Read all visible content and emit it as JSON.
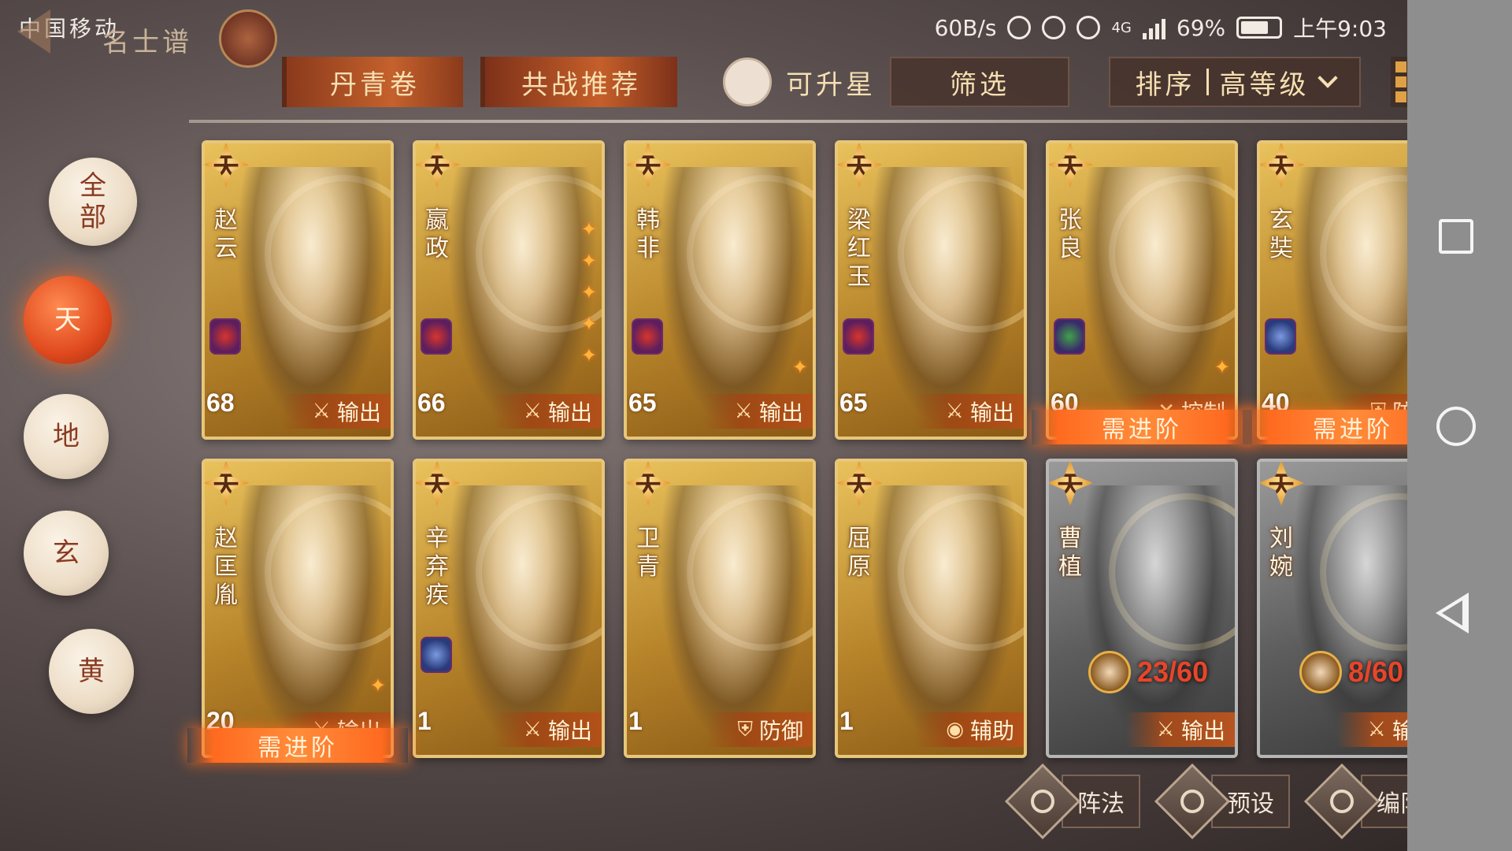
{
  "status_bar": {
    "carrier": "中国移动",
    "speed": "60B/s",
    "network": "4G",
    "battery": "69%",
    "time": "上午9:03"
  },
  "header": {
    "title": "名士谱"
  },
  "toolbar": {
    "danqing": "丹青卷",
    "gongzhan": "共战推荐",
    "upgradable": "可升星",
    "filter": "筛选",
    "sort_label": "排序",
    "sort_value": "高等级"
  },
  "filters": {
    "all": "全部",
    "tian": "天",
    "di": "地",
    "xuan": "玄",
    "huang": "黄"
  },
  "cards": [
    {
      "grade": "天",
      "name": "赵云",
      "level": "68",
      "role": "输出",
      "role_icon": "sword-icon",
      "faction": "red",
      "stars": 0,
      "gray": false,
      "advance": ""
    },
    {
      "grade": "天",
      "name": "嬴政",
      "level": "66",
      "role": "输出",
      "role_icon": "sword-icon",
      "faction": "red",
      "stars": 5,
      "gray": false,
      "advance": ""
    },
    {
      "grade": "天",
      "name": "韩非",
      "level": "65",
      "role": "输出",
      "role_icon": "sword-icon",
      "faction": "red",
      "stars": 1,
      "gray": false,
      "advance": ""
    },
    {
      "grade": "天",
      "name": "梁红玉",
      "level": "65",
      "role": "输出",
      "role_icon": "sword-icon",
      "faction": "red",
      "stars": 0,
      "gray": false,
      "advance": ""
    },
    {
      "grade": "天",
      "name": "张良",
      "level": "60",
      "role": "控制",
      "role_icon": "control-icon",
      "faction": "green",
      "stars": 1,
      "gray": false,
      "advance": "需进阶"
    },
    {
      "grade": "天",
      "name": "玄奘",
      "level": "40",
      "role": "防御",
      "role_icon": "shield-icon",
      "faction": "blue",
      "stars": 0,
      "gray": false,
      "advance": "需进阶"
    },
    {
      "grade": "天",
      "name": "赵匡胤",
      "level": "20",
      "role": "输出",
      "role_icon": "sword-icon",
      "faction": "red",
      "stars": 1,
      "gray": false,
      "advance": "需进阶"
    },
    {
      "grade": "天",
      "name": "辛弃疾",
      "level": "1",
      "role": "输出",
      "role_icon": "sword-icon",
      "faction": "blue",
      "stars": 0,
      "gray": false,
      "advance": ""
    },
    {
      "grade": "天",
      "name": "卫青",
      "level": "1",
      "role": "防御",
      "role_icon": "shield-icon",
      "faction": "",
      "stars": 0,
      "gray": false,
      "advance": ""
    },
    {
      "grade": "天",
      "name": "屈原",
      "level": "1",
      "role": "辅助",
      "role_icon": "support-icon",
      "faction": "",
      "stars": 0,
      "gray": false,
      "advance": ""
    },
    {
      "grade": "天",
      "name": "曹植",
      "level": "",
      "role": "输出",
      "role_icon": "sword-icon",
      "faction": "",
      "stars": 0,
      "gray": true,
      "advance": "",
      "fragments": "23/60"
    },
    {
      "grade": "天",
      "name": "刘婉",
      "level": "",
      "role": "输出",
      "role_icon": "sword-icon",
      "faction": "",
      "stars": 0,
      "gray": true,
      "advance": "",
      "fragments": "8/60"
    }
  ],
  "bottom_buttons": {
    "formation": "阵法",
    "preset": "预设",
    "team": "编队"
  },
  "colors": {
    "accent": "#e04a1e",
    "gold": "#e8c67a",
    "fragment_red": "#e8452a"
  }
}
